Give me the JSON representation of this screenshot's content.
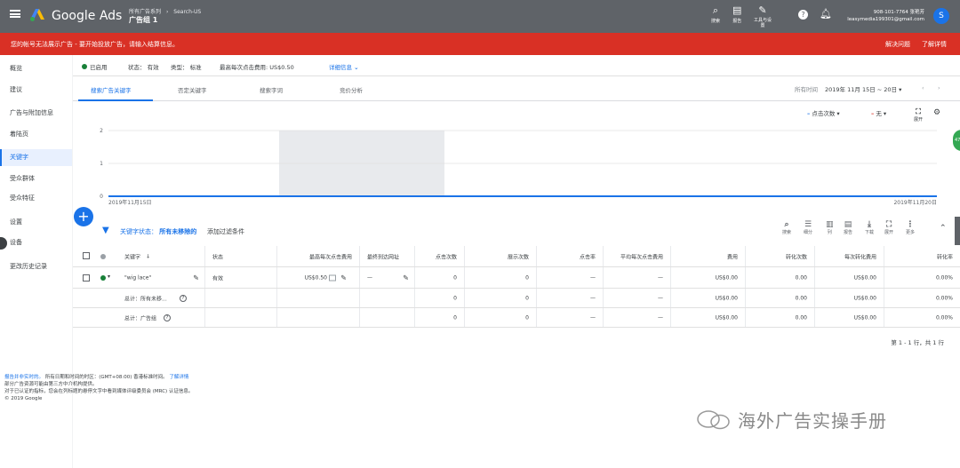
{
  "topbar": {
    "brand": "Google Ads",
    "crumb1": "所有广告系列",
    "crumb2": "Search-US",
    "adgroup": "广告组 1",
    "tools": [
      {
        "icon": "search-icon",
        "label": "搜索"
      },
      {
        "icon": "report-icon",
        "label": "报告"
      },
      {
        "icon": "wrench-icon",
        "label": "工具与设\n置"
      }
    ],
    "account_line1": "908-101-7764 张艳芳",
    "account_line2": "leasymedia199301@gmail.com",
    "avatar": "S"
  },
  "banner": {
    "message": "您的帐号无法展示广告 - 要开始投放广告，请输入结算信息。",
    "action1": "解决问题",
    "action2": "了解详情",
    "color": "#d93025"
  },
  "sidebar": {
    "items": [
      {
        "label": "概览"
      },
      {
        "label": "建议"
      },
      {
        "label": "广告与附加信息"
      },
      {
        "label": "着陆页"
      },
      {
        "label": "关键字"
      },
      {
        "label": "受众群体"
      },
      {
        "label": "受众特征"
      },
      {
        "label": "设置"
      },
      {
        "label": "设备"
      },
      {
        "label": "更改历史记录"
      }
    ]
  },
  "statusbar": {
    "enabled": "已启用",
    "status": "状态： 有效",
    "type": "类型： 标准",
    "max_cpc": "最高每次点击费用: US$0.50",
    "details": "详细信息"
  },
  "tabs": [
    {
      "label": "搜索广告关键字"
    },
    {
      "label": "否定关键字"
    },
    {
      "label": "搜索字词"
    },
    {
      "label": "竞价分析"
    }
  ],
  "date": {
    "label": "所有时间",
    "range": "2019年 11月 15日 ~ 20日"
  },
  "chart_data": {
    "type": "line",
    "x": [
      "2019年11月15日",
      "2019年11月20日"
    ],
    "series": [
      {
        "name": "点击次数",
        "values": [
          0,
          0
        ]
      }
    ],
    "secondary_metric": "无",
    "ylim": [
      0,
      2
    ],
    "yticks": [
      "2",
      "1",
      "0"
    ],
    "xlabel_start": "2019年11月15日",
    "xlabel_end": "2019年11月20日",
    "expand_label": "展开",
    "colors": {
      "primary": "#1a73e8",
      "secondary": "#d93025"
    }
  },
  "filter": {
    "prefix": "关键字状态：",
    "value": "所有未移除的",
    "add": "添加过滤条件"
  },
  "toolbar": [
    {
      "icon": "search-icon",
      "label": "搜索"
    },
    {
      "icon": "segment-icon",
      "label": "细分"
    },
    {
      "icon": "columns-icon",
      "label": "列"
    },
    {
      "icon": "report-icon",
      "label": "报告"
    },
    {
      "icon": "download-icon",
      "label": "下载"
    },
    {
      "icon": "expand-icon",
      "label": "展开"
    },
    {
      "icon": "more-icon",
      "label": "更多"
    }
  ],
  "table": {
    "headers": [
      "关键字",
      "状态",
      "最高每次点击费用",
      "最终到达网址",
      "点击次数",
      "展示次数",
      "点击率",
      "平均每次点击费用",
      "费用",
      "转化次数",
      "每次转化费用",
      "转化率"
    ],
    "rows": [
      {
        "keyword": "\"wig lace\"",
        "status": "有效",
        "cpc": "US$0.50",
        "url": "—",
        "clicks": "0",
        "impr": "0",
        "ctr": "—",
        "avg_cpc": "—",
        "cost": "US$0.00",
        "conv": "0.00",
        "cost_conv": "US$0.00",
        "conv_rate": "0.00%"
      },
      {
        "keyword": "总计：所有未移...",
        "status": "",
        "cpc": "",
        "url": "",
        "clicks": "0",
        "impr": "0",
        "ctr": "—",
        "avg_cpc": "—",
        "cost": "US$0.00",
        "conv": "0.00",
        "cost_conv": "US$0.00",
        "conv_rate": "0.00%"
      },
      {
        "keyword": "总计：广告组",
        "status": "",
        "cpc": "",
        "url": "",
        "clicks": "0",
        "impr": "0",
        "ctr": "—",
        "avg_cpc": "—",
        "cost": "US$0.00",
        "conv": "0.00",
        "cost_conv": "US$0.00",
        "conv_rate": "0.00%"
      }
    ]
  },
  "pager": "第 1 - 1 行，共 1 行",
  "footer": {
    "line1_link": "报告并非实时的。",
    "line1": "所有日期和时间的时区：(GMT+08:00) 香港标准时间。",
    "line1_learn": "了解详情",
    "line2": "部分广告资源可能由第三方中介机构提供。",
    "line3": "对于已认证的指标，您会在列标题的悬停文字中看到媒体评级委员会 (MRC) 认证信息。",
    "line4": "© 2019 Google"
  },
  "watermark": "海外广告实操手册",
  "edge_badge": "47"
}
